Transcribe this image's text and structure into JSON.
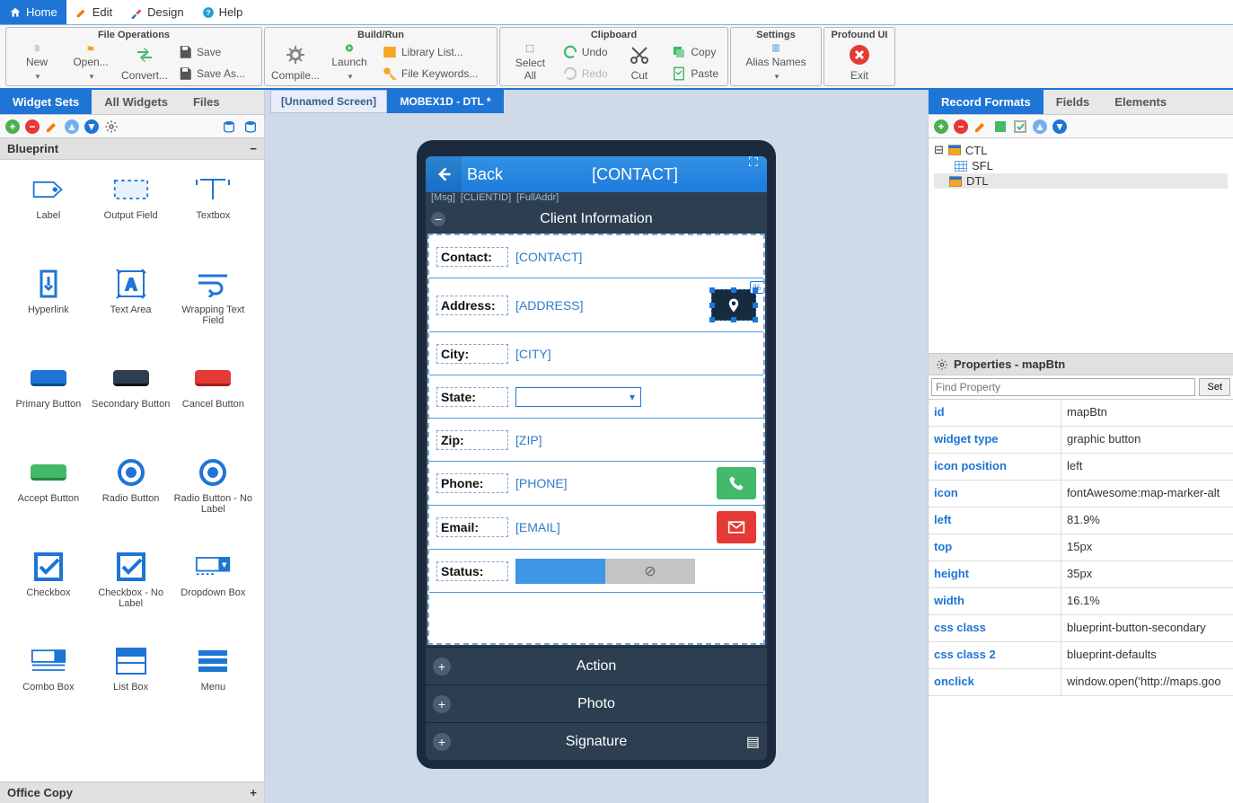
{
  "menubar": {
    "home": "Home",
    "edit": "Edit",
    "design": "Design",
    "help": "Help"
  },
  "ribbon": {
    "fileops": {
      "title": "File Operations",
      "new": "New",
      "open": "Open...",
      "convert": "Convert...",
      "save": "Save",
      "saveas": "Save As..."
    },
    "buildrun": {
      "title": "Build/Run",
      "compile": "Compile...",
      "launch": "Launch",
      "liblist": "Library List...",
      "filekw": "File Keywords..."
    },
    "clipboard": {
      "title": "Clipboard",
      "selectall": "Select All",
      "undo": "Undo",
      "redo": "Redo",
      "cut": "Cut",
      "copy": "Copy",
      "paste": "Paste"
    },
    "settings": {
      "title": "Settings",
      "alias": "Alias Names"
    },
    "profound": {
      "title": "Profound UI",
      "exit": "Exit"
    }
  },
  "leftPanel": {
    "tabs": {
      "widgetSets": "Widget Sets",
      "allWidgets": "All Widgets",
      "files": "Files"
    },
    "blueprint": "Blueprint",
    "officeCopy": "Office Copy",
    "widgets": [
      "Label",
      "Output Field",
      "Textbox",
      "Hyperlink",
      "Text Area",
      "Wrapping Text Field",
      "Primary Button",
      "Secondary Button",
      "Cancel Button",
      "Accept Button",
      "Radio Button",
      "Radio Button - No Label",
      "Checkbox",
      "Checkbox - No Label",
      "Dropdown Box",
      "Combo Box",
      "List Box",
      "Menu"
    ]
  },
  "canvas": {
    "tabs": {
      "unnamed": "[Unnamed Screen]",
      "mobex": "MOBEX1D - DTL *"
    }
  },
  "mobile": {
    "back": "Back",
    "title": "[CONTACT]",
    "msg": "[Msg]",
    "clientid": "[CLIENTID]",
    "fulladdr": "[FullAddr]",
    "section": "Client Information",
    "labels": {
      "contact": "Contact:",
      "address": "Address:",
      "city": "City:",
      "state": "State:",
      "zip": "Zip:",
      "phone": "Phone:",
      "email": "Email:",
      "status": "Status:"
    },
    "values": {
      "contact": "[CONTACT]",
      "address": "[ADDRESS]",
      "city": "[CITY]",
      "zip": "[ZIP]",
      "phone": "[PHONE]",
      "email": "[EMAIL]"
    },
    "actions": {
      "action": "Action",
      "photo": "Photo",
      "signature": "Signature"
    }
  },
  "rightPanel": {
    "tabs": {
      "formats": "Record Formats",
      "fields": "Fields",
      "elements": "Elements"
    },
    "tree": {
      "ctl": "CTL",
      "sfl": "SFL",
      "dtl": "DTL"
    },
    "propsTitle": "Properties - mapBtn",
    "filterPlaceholder": "Find Property",
    "setBtn": "Set",
    "props": [
      {
        "name": "id",
        "val": "mapBtn"
      },
      {
        "name": "widget type",
        "val": "graphic button"
      },
      {
        "name": "icon position",
        "val": "left"
      },
      {
        "name": "icon",
        "val": "fontAwesome:map-marker-alt"
      },
      {
        "name": "left",
        "val": "81.9%"
      },
      {
        "name": "top",
        "val": "15px"
      },
      {
        "name": "height",
        "val": "35px"
      },
      {
        "name": "width",
        "val": "16.1%"
      },
      {
        "name": "css class",
        "val": "blueprint-button-secondary"
      },
      {
        "name": "css class 2",
        "val": "blueprint-defaults"
      },
      {
        "name": "onclick",
        "val": "window.open('http://maps.goo"
      }
    ]
  }
}
